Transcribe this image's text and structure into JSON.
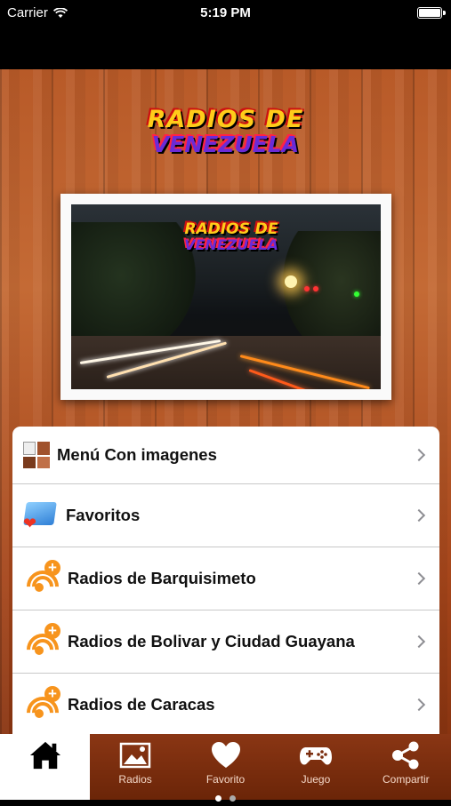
{
  "status_bar": {
    "carrier": "Carrier",
    "time": "5:19 PM"
  },
  "header": {
    "logo_line1": "RADIOS DE",
    "logo_line2": "VENEZUELA"
  },
  "photo": {
    "logo_line1": "RADIOS DE",
    "logo_line2": "VENEZUELA"
  },
  "menu": {
    "items": [
      {
        "label": "Menú Con imagenes",
        "icon": "image-grid-icon"
      },
      {
        "label": "Favoritos",
        "icon": "favorites-folder-icon"
      },
      {
        "label": "Radios de Barquisimeto",
        "icon": "rss-add-icon"
      },
      {
        "label": "Radios de Bolivar y Ciudad Guayana",
        "icon": "rss-add-icon"
      },
      {
        "label": "Radios de Caracas",
        "icon": "rss-add-icon"
      }
    ]
  },
  "tabbar": {
    "tabs": [
      {
        "label": "",
        "icon": "home-icon",
        "active": true
      },
      {
        "label": "Radios",
        "icon": "picture-icon"
      },
      {
        "label": "Favorito",
        "icon": "heart-icon"
      },
      {
        "label": "Juego",
        "icon": "gamepad-icon"
      },
      {
        "label": "Compartir",
        "icon": "share-icon"
      }
    ],
    "page_indicator": {
      "pages": 2,
      "current": 1
    }
  },
  "colors": {
    "wood": "#b85a28",
    "tabbar": "#7a2d0e",
    "rss_orange": "#f7941d"
  }
}
